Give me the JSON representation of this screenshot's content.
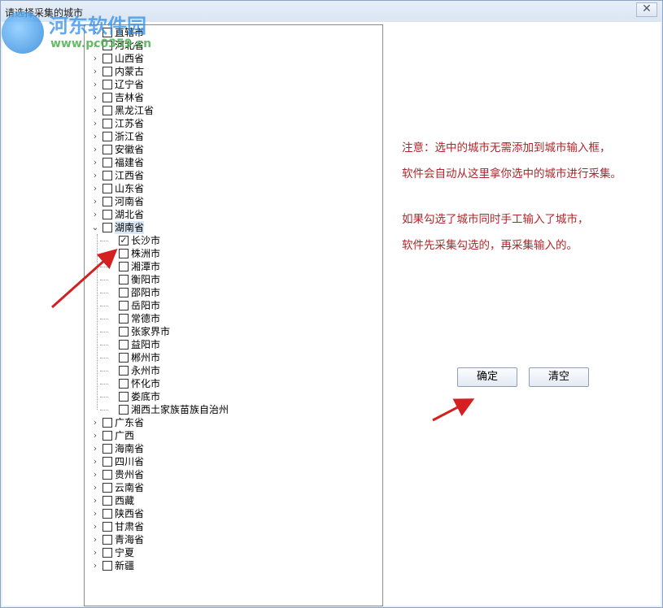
{
  "window": {
    "title": "请选择采集的城市",
    "close_label": "✕"
  },
  "watermark": {
    "name": "河东软件园",
    "url": "www.pc0359.cn"
  },
  "tree": {
    "provinces_before": [
      {
        "label": "直辖市",
        "checked": false
      },
      {
        "label": "河北省",
        "checked": false
      },
      {
        "label": "山西省",
        "checked": false
      },
      {
        "label": "内蒙古",
        "checked": false
      },
      {
        "label": "辽宁省",
        "checked": false
      },
      {
        "label": "吉林省",
        "checked": false
      },
      {
        "label": "黑龙江省",
        "checked": false
      },
      {
        "label": "江苏省",
        "checked": false
      },
      {
        "label": "浙江省",
        "checked": false
      },
      {
        "label": "安徽省",
        "checked": false
      },
      {
        "label": "福建省",
        "checked": false
      },
      {
        "label": "江西省",
        "checked": false
      },
      {
        "label": "山东省",
        "checked": false
      },
      {
        "label": "河南省",
        "checked": false
      },
      {
        "label": "湖北省",
        "checked": false
      }
    ],
    "expanded_province": {
      "label": "湖南省",
      "checked": false
    },
    "cities": [
      {
        "label": "长沙市",
        "checked": true
      },
      {
        "label": "株洲市",
        "checked": false
      },
      {
        "label": "湘潭市",
        "checked": false
      },
      {
        "label": "衡阳市",
        "checked": false
      },
      {
        "label": "邵阳市",
        "checked": false
      },
      {
        "label": "岳阳市",
        "checked": false
      },
      {
        "label": "常德市",
        "checked": false
      },
      {
        "label": "张家界市",
        "checked": false
      },
      {
        "label": "益阳市",
        "checked": false
      },
      {
        "label": "郴州市",
        "checked": false
      },
      {
        "label": "永州市",
        "checked": false
      },
      {
        "label": "怀化市",
        "checked": false
      },
      {
        "label": "娄底市",
        "checked": false
      },
      {
        "label": "湘西土家族苗族自治州",
        "checked": false
      }
    ],
    "provinces_after": [
      {
        "label": "广东省",
        "checked": false
      },
      {
        "label": "广西",
        "checked": false
      },
      {
        "label": "海南省",
        "checked": false
      },
      {
        "label": "四川省",
        "checked": false
      },
      {
        "label": "贵州省",
        "checked": false
      },
      {
        "label": "云南省",
        "checked": false
      },
      {
        "label": "西藏",
        "checked": false
      },
      {
        "label": "陕西省",
        "checked": false
      },
      {
        "label": "甘肃省",
        "checked": false
      },
      {
        "label": "青海省",
        "checked": false
      },
      {
        "label": "宁夏",
        "checked": false
      },
      {
        "label": "新疆",
        "checked": false
      }
    ]
  },
  "notes": {
    "line1": "注意：选中的城市无需添加到城市输入框，",
    "line2": "软件会自动从这里拿你选中的城市进行采集。",
    "line3": "如果勾选了城市同时手工输入了城市，",
    "line4": "软件先采集勾选的，再采集输入的。"
  },
  "buttons": {
    "confirm_label": "确定",
    "clear_label": "清空"
  },
  "icons": {
    "collapsed": "chevron-right-icon",
    "expanded": "chevron-down-icon",
    "checked": "check-icon"
  },
  "colors": {
    "note_text": "#b0262a",
    "arrow": "#d42020"
  }
}
